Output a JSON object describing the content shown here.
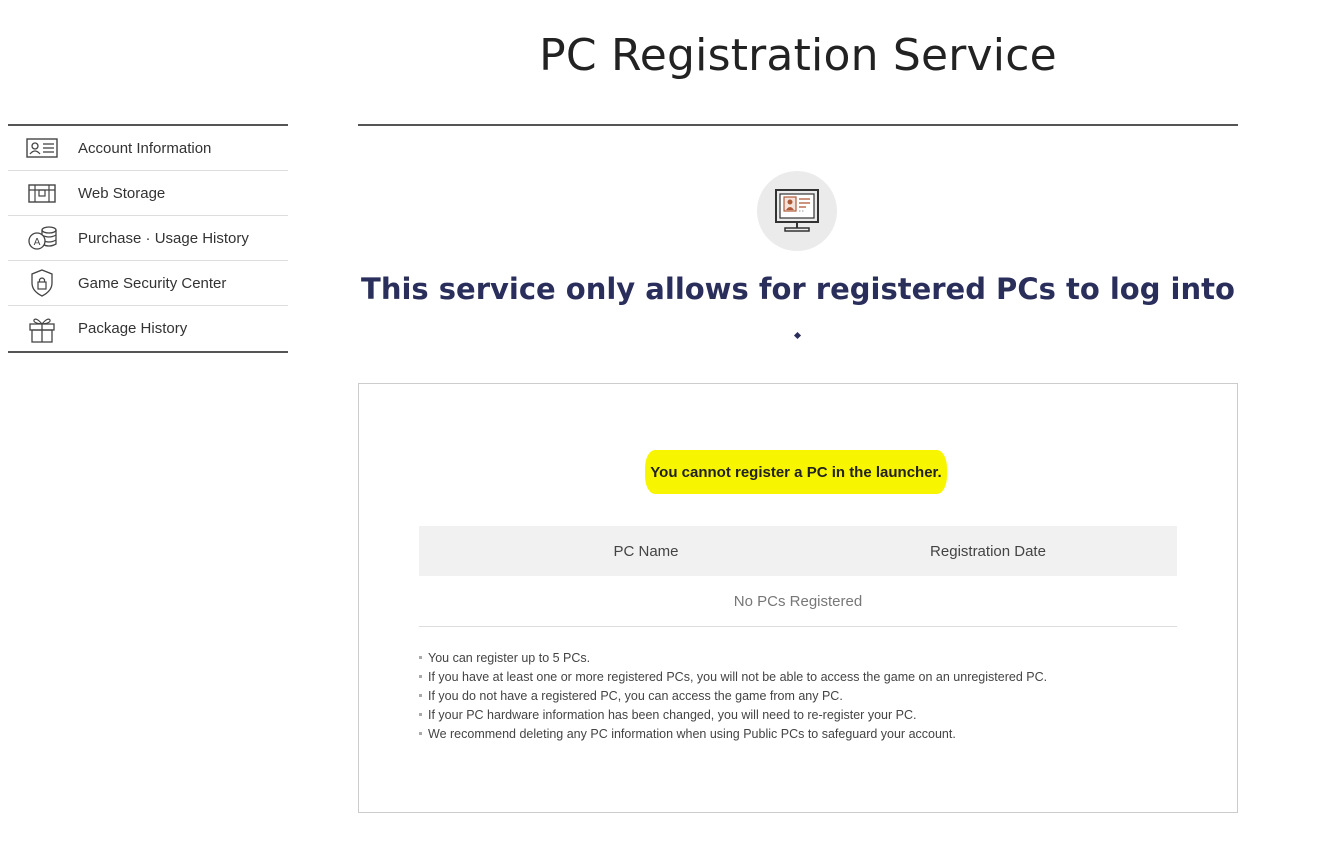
{
  "page": {
    "title": "PC Registration Service"
  },
  "sidebar": {
    "items": [
      {
        "label": "Account Information",
        "icon": "id-card-icon"
      },
      {
        "label": "Web Storage",
        "icon": "storage-chest-icon"
      },
      {
        "label": "Purchase · Usage History",
        "icon": "coins-icon"
      },
      {
        "label": "Game Security Center",
        "icon": "shield-lock-icon"
      },
      {
        "label": "Package History",
        "icon": "gift-icon"
      }
    ]
  },
  "main": {
    "icon": "pc-monitor-icon",
    "subtitle": "This service only allows for registered PCs to log into",
    "notice": "You cannot register a PC in the launcher.",
    "table": {
      "columns": [
        "PC Name",
        "Registration Date"
      ],
      "empty_text": "No PCs Registered"
    },
    "notes": [
      "You can register up to 5 PCs.",
      "If you have at least one or more registered PCs, you will not be able to access the game on an unregistered PC.",
      "If you do not have a registered PC, you can access the game from any PC.",
      "If your PC hardware information has been changed, you will need to re-register your PC.",
      "We recommend deleting any PC information when using Public PCs to safeguard your account."
    ]
  },
  "colors": {
    "highlight": "#f8f500",
    "subtitle": "#2a2e5a",
    "icon_accent": "#b05a3a"
  }
}
